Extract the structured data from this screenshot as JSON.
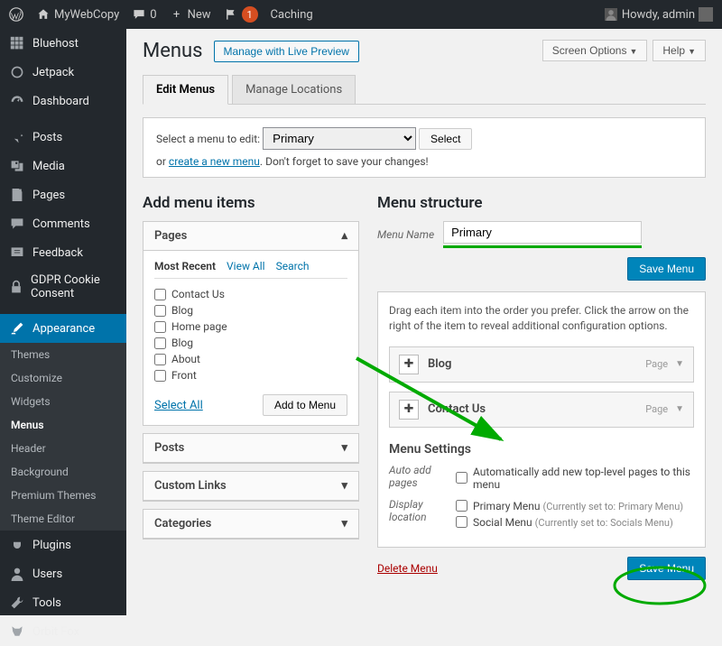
{
  "topbar": {
    "site_name": "MyWebCopy",
    "comments_count": "0",
    "new_label": "New",
    "notif_count": "1",
    "caching_label": "Caching",
    "howdy": "Howdy, admin"
  },
  "sidebar": {
    "items": [
      {
        "label": "Bluehost",
        "icon": "grid"
      },
      {
        "label": "Jetpack",
        "icon": "circle"
      },
      {
        "label": "Dashboard",
        "icon": "gauge"
      },
      {
        "label": "Posts",
        "icon": "pin"
      },
      {
        "label": "Media",
        "icon": "media"
      },
      {
        "label": "Pages",
        "icon": "page"
      },
      {
        "label": "Comments",
        "icon": "chat"
      },
      {
        "label": "Feedback",
        "icon": "feedback"
      },
      {
        "label": "GDPR Cookie Consent",
        "icon": "lock"
      },
      {
        "label": "Appearance",
        "icon": "brush",
        "active": true
      },
      {
        "label": "Plugins",
        "icon": "plug"
      },
      {
        "label": "Users",
        "icon": "user"
      },
      {
        "label": "Tools",
        "icon": "wrench"
      },
      {
        "label": "Orbit Fox",
        "icon": "fox"
      }
    ],
    "appearance_sub": [
      "Themes",
      "Customize",
      "Widgets",
      "Menus",
      "Header",
      "Background",
      "Premium Themes",
      "Theme Editor"
    ],
    "appearance_current": "Menus"
  },
  "screen_options": "Screen Options",
  "help": "Help",
  "page_title": "Menus",
  "preview_btn": "Manage with Live Preview",
  "tabs": {
    "edit": "Edit Menus",
    "locations": "Manage Locations"
  },
  "select_box": {
    "label": "Select a menu to edit:",
    "selected": "Primary",
    "select_btn": "Select",
    "or": "or",
    "create_link": "create a new menu",
    "suffix": ". Don't forget to save your changes!"
  },
  "add_items": {
    "heading": "Add menu items",
    "pages": {
      "title": "Pages",
      "inner_tabs": [
        "Most Recent",
        "View All",
        "Search"
      ],
      "items": [
        "Contact Us",
        "Blog",
        "Home page",
        "Blog",
        "About",
        "Front"
      ],
      "select_all": "Select All",
      "add_btn": "Add to Menu"
    },
    "posts": "Posts",
    "custom_links": "Custom Links",
    "categories": "Categories"
  },
  "structure": {
    "heading": "Menu structure",
    "name_label": "Menu Name",
    "name_value": "Primary",
    "save_btn": "Save Menu",
    "instructions": "Drag each item into the order you prefer. Click the arrow on the right of the item to reveal additional configuration options.",
    "items": [
      {
        "label": "Blog",
        "type": "Page"
      },
      {
        "label": "Contact Us",
        "type": "Page"
      }
    ],
    "settings": {
      "heading": "Menu Settings",
      "auto_label": "Auto add pages",
      "auto_opt": "Automatically add new top-level pages to this menu",
      "display_label": "Display location",
      "display_opts": [
        {
          "label": "Primary Menu",
          "hint": "(Currently set to: Primary Menu)"
        },
        {
          "label": "Social Menu",
          "hint": "(Currently set to: Socials Menu)"
        }
      ]
    },
    "delete": "Delete Menu"
  }
}
